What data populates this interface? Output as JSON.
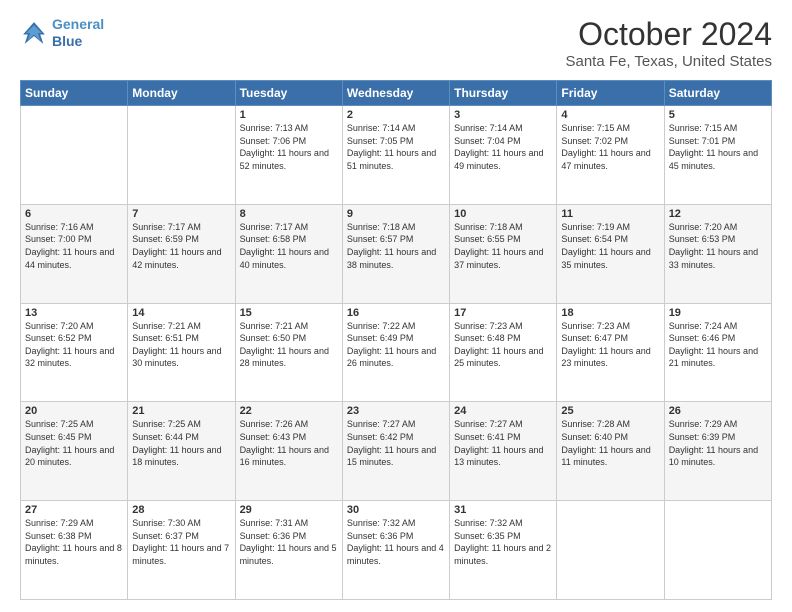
{
  "header": {
    "logo_line1": "General",
    "logo_line2": "Blue",
    "month": "October 2024",
    "location": "Santa Fe, Texas, United States"
  },
  "weekdays": [
    "Sunday",
    "Monday",
    "Tuesday",
    "Wednesday",
    "Thursday",
    "Friday",
    "Saturday"
  ],
  "weeks": [
    [
      {
        "day": "",
        "sunrise": "",
        "sunset": "",
        "daylight": ""
      },
      {
        "day": "",
        "sunrise": "",
        "sunset": "",
        "daylight": ""
      },
      {
        "day": "1",
        "sunrise": "Sunrise: 7:13 AM",
        "sunset": "Sunset: 7:06 PM",
        "daylight": "Daylight: 11 hours and 52 minutes."
      },
      {
        "day": "2",
        "sunrise": "Sunrise: 7:14 AM",
        "sunset": "Sunset: 7:05 PM",
        "daylight": "Daylight: 11 hours and 51 minutes."
      },
      {
        "day": "3",
        "sunrise": "Sunrise: 7:14 AM",
        "sunset": "Sunset: 7:04 PM",
        "daylight": "Daylight: 11 hours and 49 minutes."
      },
      {
        "day": "4",
        "sunrise": "Sunrise: 7:15 AM",
        "sunset": "Sunset: 7:02 PM",
        "daylight": "Daylight: 11 hours and 47 minutes."
      },
      {
        "day": "5",
        "sunrise": "Sunrise: 7:15 AM",
        "sunset": "Sunset: 7:01 PM",
        "daylight": "Daylight: 11 hours and 45 minutes."
      }
    ],
    [
      {
        "day": "6",
        "sunrise": "Sunrise: 7:16 AM",
        "sunset": "Sunset: 7:00 PM",
        "daylight": "Daylight: 11 hours and 44 minutes."
      },
      {
        "day": "7",
        "sunrise": "Sunrise: 7:17 AM",
        "sunset": "Sunset: 6:59 PM",
        "daylight": "Daylight: 11 hours and 42 minutes."
      },
      {
        "day": "8",
        "sunrise": "Sunrise: 7:17 AM",
        "sunset": "Sunset: 6:58 PM",
        "daylight": "Daylight: 11 hours and 40 minutes."
      },
      {
        "day": "9",
        "sunrise": "Sunrise: 7:18 AM",
        "sunset": "Sunset: 6:57 PM",
        "daylight": "Daylight: 11 hours and 38 minutes."
      },
      {
        "day": "10",
        "sunrise": "Sunrise: 7:18 AM",
        "sunset": "Sunset: 6:55 PM",
        "daylight": "Daylight: 11 hours and 37 minutes."
      },
      {
        "day": "11",
        "sunrise": "Sunrise: 7:19 AM",
        "sunset": "Sunset: 6:54 PM",
        "daylight": "Daylight: 11 hours and 35 minutes."
      },
      {
        "day": "12",
        "sunrise": "Sunrise: 7:20 AM",
        "sunset": "Sunset: 6:53 PM",
        "daylight": "Daylight: 11 hours and 33 minutes."
      }
    ],
    [
      {
        "day": "13",
        "sunrise": "Sunrise: 7:20 AM",
        "sunset": "Sunset: 6:52 PM",
        "daylight": "Daylight: 11 hours and 32 minutes."
      },
      {
        "day": "14",
        "sunrise": "Sunrise: 7:21 AM",
        "sunset": "Sunset: 6:51 PM",
        "daylight": "Daylight: 11 hours and 30 minutes."
      },
      {
        "day": "15",
        "sunrise": "Sunrise: 7:21 AM",
        "sunset": "Sunset: 6:50 PM",
        "daylight": "Daylight: 11 hours and 28 minutes."
      },
      {
        "day": "16",
        "sunrise": "Sunrise: 7:22 AM",
        "sunset": "Sunset: 6:49 PM",
        "daylight": "Daylight: 11 hours and 26 minutes."
      },
      {
        "day": "17",
        "sunrise": "Sunrise: 7:23 AM",
        "sunset": "Sunset: 6:48 PM",
        "daylight": "Daylight: 11 hours and 25 minutes."
      },
      {
        "day": "18",
        "sunrise": "Sunrise: 7:23 AM",
        "sunset": "Sunset: 6:47 PM",
        "daylight": "Daylight: 11 hours and 23 minutes."
      },
      {
        "day": "19",
        "sunrise": "Sunrise: 7:24 AM",
        "sunset": "Sunset: 6:46 PM",
        "daylight": "Daylight: 11 hours and 21 minutes."
      }
    ],
    [
      {
        "day": "20",
        "sunrise": "Sunrise: 7:25 AM",
        "sunset": "Sunset: 6:45 PM",
        "daylight": "Daylight: 11 hours and 20 minutes."
      },
      {
        "day": "21",
        "sunrise": "Sunrise: 7:25 AM",
        "sunset": "Sunset: 6:44 PM",
        "daylight": "Daylight: 11 hours and 18 minutes."
      },
      {
        "day": "22",
        "sunrise": "Sunrise: 7:26 AM",
        "sunset": "Sunset: 6:43 PM",
        "daylight": "Daylight: 11 hours and 16 minutes."
      },
      {
        "day": "23",
        "sunrise": "Sunrise: 7:27 AM",
        "sunset": "Sunset: 6:42 PM",
        "daylight": "Daylight: 11 hours and 15 minutes."
      },
      {
        "day": "24",
        "sunrise": "Sunrise: 7:27 AM",
        "sunset": "Sunset: 6:41 PM",
        "daylight": "Daylight: 11 hours and 13 minutes."
      },
      {
        "day": "25",
        "sunrise": "Sunrise: 7:28 AM",
        "sunset": "Sunset: 6:40 PM",
        "daylight": "Daylight: 11 hours and 11 minutes."
      },
      {
        "day": "26",
        "sunrise": "Sunrise: 7:29 AM",
        "sunset": "Sunset: 6:39 PM",
        "daylight": "Daylight: 11 hours and 10 minutes."
      }
    ],
    [
      {
        "day": "27",
        "sunrise": "Sunrise: 7:29 AM",
        "sunset": "Sunset: 6:38 PM",
        "daylight": "Daylight: 11 hours and 8 minutes."
      },
      {
        "day": "28",
        "sunrise": "Sunrise: 7:30 AM",
        "sunset": "Sunset: 6:37 PM",
        "daylight": "Daylight: 11 hours and 7 minutes."
      },
      {
        "day": "29",
        "sunrise": "Sunrise: 7:31 AM",
        "sunset": "Sunset: 6:36 PM",
        "daylight": "Daylight: 11 hours and 5 minutes."
      },
      {
        "day": "30",
        "sunrise": "Sunrise: 7:32 AM",
        "sunset": "Sunset: 6:36 PM",
        "daylight": "Daylight: 11 hours and 4 minutes."
      },
      {
        "day": "31",
        "sunrise": "Sunrise: 7:32 AM",
        "sunset": "Sunset: 6:35 PM",
        "daylight": "Daylight: 11 hours and 2 minutes."
      },
      {
        "day": "",
        "sunrise": "",
        "sunset": "",
        "daylight": ""
      },
      {
        "day": "",
        "sunrise": "",
        "sunset": "",
        "daylight": ""
      }
    ]
  ]
}
